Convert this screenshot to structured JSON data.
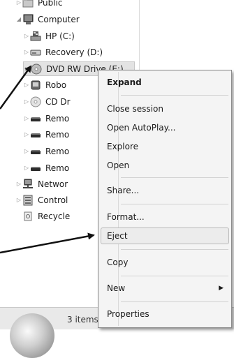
{
  "tree": {
    "items": [
      {
        "label": "Public",
        "expanded": false,
        "icon": "public-folder-icon"
      },
      {
        "label": "Computer",
        "expanded": true,
        "icon": "computer-icon"
      },
      {
        "label": "HP (C:)",
        "expanded": false,
        "icon": "hard-drive-windows-icon"
      },
      {
        "label": "Recovery (D:)",
        "expanded": false,
        "icon": "hard-drive-icon"
      },
      {
        "label": "DVD RW Drive (E:)",
        "expanded": false,
        "icon": "dvd-drive-icon",
        "selected": true
      },
      {
        "label": "Robo",
        "expanded": false,
        "icon": "robot-drive-icon"
      },
      {
        "label": "CD Dr",
        "expanded": false,
        "icon": "cd-drive-icon"
      },
      {
        "label": "Remo",
        "expanded": false,
        "icon": "removable-drive-icon"
      },
      {
        "label": "Remo",
        "expanded": false,
        "icon": "removable-drive-icon"
      },
      {
        "label": "Remo",
        "expanded": false,
        "icon": "removable-drive-icon"
      },
      {
        "label": "Remo",
        "expanded": false,
        "icon": "removable-drive-icon"
      },
      {
        "label": "Networ",
        "expanded": false,
        "icon": "network-icon"
      },
      {
        "label": "Control",
        "expanded": false,
        "icon": "control-panel-icon"
      },
      {
        "label": "Recycle",
        "expanded": null,
        "icon": "recycle-bin-icon"
      }
    ]
  },
  "context_menu": {
    "items": [
      {
        "label": "Expand",
        "bold": true
      },
      {
        "label": "Close session"
      },
      {
        "label": "Open AutoPlay..."
      },
      {
        "label": "Explore"
      },
      {
        "label": "Open"
      },
      {
        "label": "Share..."
      },
      {
        "label": "Format..."
      },
      {
        "label": "Eject",
        "highlighted": true
      },
      {
        "label": "Copy"
      },
      {
        "label": "New",
        "submenu": true
      },
      {
        "label": "Properties"
      }
    ],
    "submenu_arrow": "▶"
  },
  "status_bar": {
    "text": "3 items"
  },
  "colors": {
    "menu_background": "#f4f4f4",
    "highlight": "#ececec",
    "annotation_arrow": "#111111"
  }
}
